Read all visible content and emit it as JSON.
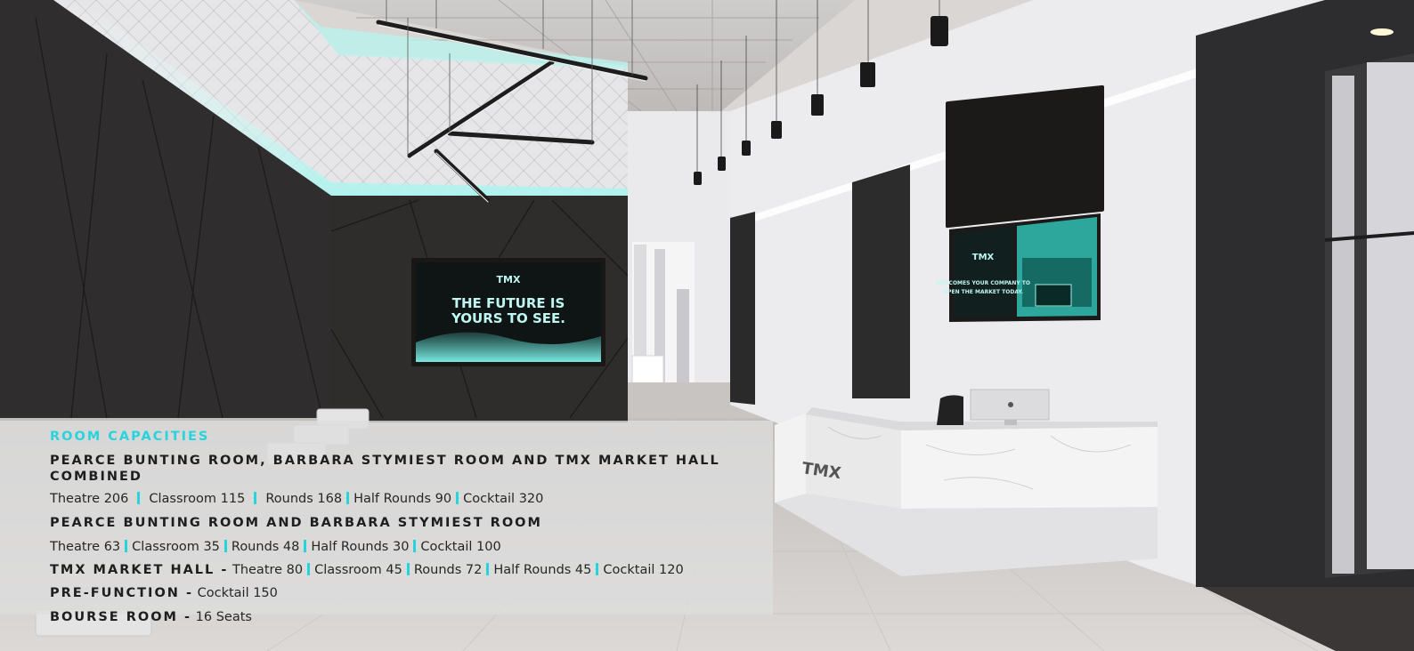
{
  "tv_left": {
    "logo": "TMX",
    "line1": "THE FUTURE IS",
    "line2": "YOURS TO SEE."
  },
  "tv_right": {
    "logo": "TMX",
    "line1": "WELCOMES YOUR COMPANY TO",
    "line2": "OPEN THE MARKET TODAY."
  },
  "desk": {
    "logo": "TMX"
  },
  "capacities": {
    "title": "ROOM CAPACITIES",
    "combined": {
      "heading": "PEARCE BUNTING ROOM, BARBARA STYMIEST ROOM AND TMX MARKET HALL COMBINED",
      "items": [
        "Theatre 206",
        "Classroom 115",
        "Rounds 168",
        "Half Rounds 90",
        "Cocktail 320"
      ]
    },
    "pb_bs": {
      "heading": "PEARCE BUNTING ROOM AND BARBARA STYMIEST ROOM",
      "items": [
        "Theatre 63",
        "Classroom 35",
        "Rounds 48",
        "Half Rounds 30",
        "Cocktail 100"
      ]
    },
    "market_hall": {
      "heading": "TMX MARKET HALL -",
      "items": [
        "Theatre 80",
        "Classroom 45",
        "Rounds 72",
        "Half Rounds 45",
        "Cocktail 120"
      ]
    },
    "pre_function": {
      "heading": "PRE-FUNCTION -",
      "value": "Cocktail 150"
    },
    "bourse": {
      "heading": "BOURSE ROOM -",
      "value": "16 Seats"
    }
  },
  "colors": {
    "accent": "#27d4dc",
    "wall_dark": "#2e2c2c",
    "wall_light": "#ecebed",
    "floor": "#d3d0cd",
    "screen_glow": "#6fe6dd"
  }
}
